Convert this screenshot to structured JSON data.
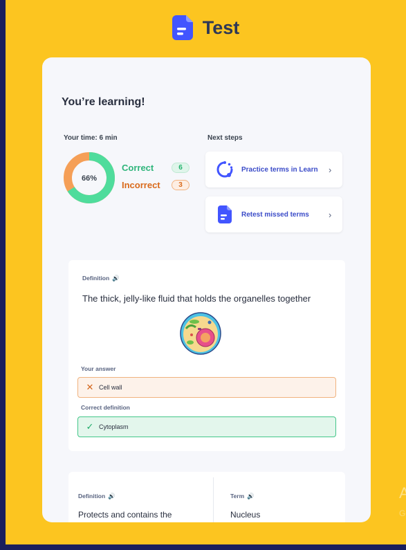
{
  "header": {
    "title": "Test",
    "icon": "test-document-icon"
  },
  "summary": {
    "heading": "You’re learning!",
    "time_label": "Your time: 6 min",
    "percent": "66%",
    "correct_fraction": 0.66,
    "correct_label": "Correct",
    "correct_count": "6",
    "incorrect_label": "Incorrect",
    "incorrect_count": "3",
    "colors": {
      "correct": "#4fdc9c",
      "incorrect": "#f59f57"
    }
  },
  "next_steps": {
    "label": "Next steps",
    "items": [
      {
        "label": "Practice terms in Learn",
        "icon": "learn-cycle-icon"
      },
      {
        "label": "Retest missed terms",
        "icon": "retest-document-icon"
      }
    ]
  },
  "question1": {
    "definition_label": "Definition",
    "speaker": "🔊",
    "definition_text": "The thick, jelly-like fluid that holds the organelles together",
    "image": "animal-cell-illustration",
    "your_answer_label": "Your answer",
    "your_answer": "Cell wall",
    "correct_label": "Correct definition",
    "correct_answer": "Cytoplasm"
  },
  "question2": {
    "definition_label": "Definition",
    "term_label": "Term",
    "speaker": "🔊",
    "definition_text": "Protects and contains the",
    "term_text": "Nucleus"
  },
  "watermark": {
    "line1": "A",
    "line2": "Go"
  }
}
